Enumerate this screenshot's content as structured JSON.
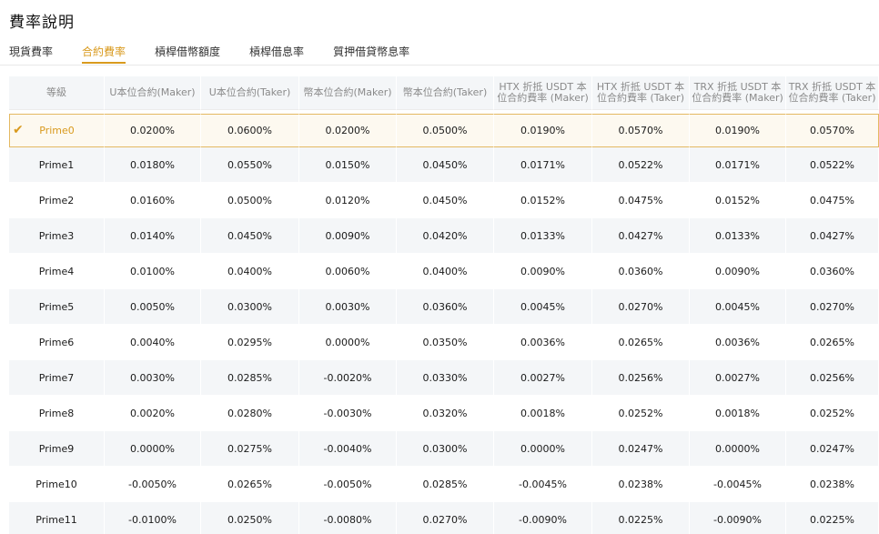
{
  "title": "費率說明",
  "tabs": [
    {
      "label": "現貨費率",
      "active": false
    },
    {
      "label": "合約費率",
      "active": true
    },
    {
      "label": "槓桿借幣額度",
      "active": false
    },
    {
      "label": "槓桿借息率",
      "active": false
    },
    {
      "label": "質押借貸幣息率",
      "active": false
    }
  ],
  "table": {
    "headers": [
      "等級",
      "U本位合約(Maker)",
      "U本位合約(Taker)",
      "幣本位合約(Maker)",
      "幣本位合約(Taker)",
      "HTX 折抵 USDT 本位合約費率 (Maker)",
      "HTX 折抵 USDT 本位合約費率 (Taker)",
      "TRX 折抵 USDT 本位合約費率 (Maker)",
      "TRX 折抵 USDT 本位合約費率 (Taker)"
    ],
    "rows": [
      [
        "Prime0",
        "0.0200%",
        "0.0600%",
        "0.0200%",
        "0.0500%",
        "0.0190%",
        "0.0570%",
        "0.0190%",
        "0.0570%"
      ],
      [
        "Prime1",
        "0.0180%",
        "0.0550%",
        "0.0150%",
        "0.0450%",
        "0.0171%",
        "0.0522%",
        "0.0171%",
        "0.0522%"
      ],
      [
        "Prime2",
        "0.0160%",
        "0.0500%",
        "0.0120%",
        "0.0450%",
        "0.0152%",
        "0.0475%",
        "0.0152%",
        "0.0475%"
      ],
      [
        "Prime3",
        "0.0140%",
        "0.0450%",
        "0.0090%",
        "0.0420%",
        "0.0133%",
        "0.0427%",
        "0.0133%",
        "0.0427%"
      ],
      [
        "Prime4",
        "0.0100%",
        "0.0400%",
        "0.0060%",
        "0.0400%",
        "0.0090%",
        "0.0360%",
        "0.0090%",
        "0.0360%"
      ],
      [
        "Prime5",
        "0.0050%",
        "0.0300%",
        "0.0030%",
        "0.0360%",
        "0.0045%",
        "0.0270%",
        "0.0045%",
        "0.0270%"
      ],
      [
        "Prime6",
        "0.0040%",
        "0.0295%",
        "0.0000%",
        "0.0350%",
        "0.0036%",
        "0.0265%",
        "0.0036%",
        "0.0265%"
      ],
      [
        "Prime7",
        "0.0030%",
        "0.0285%",
        "-0.0020%",
        "0.0330%",
        "0.0027%",
        "0.0256%",
        "0.0027%",
        "0.0256%"
      ],
      [
        "Prime8",
        "0.0020%",
        "0.0280%",
        "-0.0030%",
        "0.0320%",
        "0.0018%",
        "0.0252%",
        "0.0018%",
        "0.0252%"
      ],
      [
        "Prime9",
        "0.0000%",
        "0.0275%",
        "-0.0040%",
        "0.0300%",
        "0.0000%",
        "0.0247%",
        "0.0000%",
        "0.0247%"
      ],
      [
        "Prime10",
        "-0.0050%",
        "0.0265%",
        "-0.0050%",
        "0.0285%",
        "-0.0045%",
        "0.0238%",
        "-0.0045%",
        "0.0238%"
      ],
      [
        "Prime11",
        "-0.0100%",
        "0.0250%",
        "-0.0080%",
        "0.0270%",
        "-0.0090%",
        "0.0225%",
        "-0.0090%",
        "0.0225%"
      ]
    ],
    "selected_row": 0
  },
  "icons": {
    "selected_marker": "check-icon"
  },
  "colors": {
    "accent": "#d99a1e",
    "header_bg": "#f4f6f8",
    "stripe_bg": "#f4f6f8",
    "selected_border": "#e4b962"
  }
}
